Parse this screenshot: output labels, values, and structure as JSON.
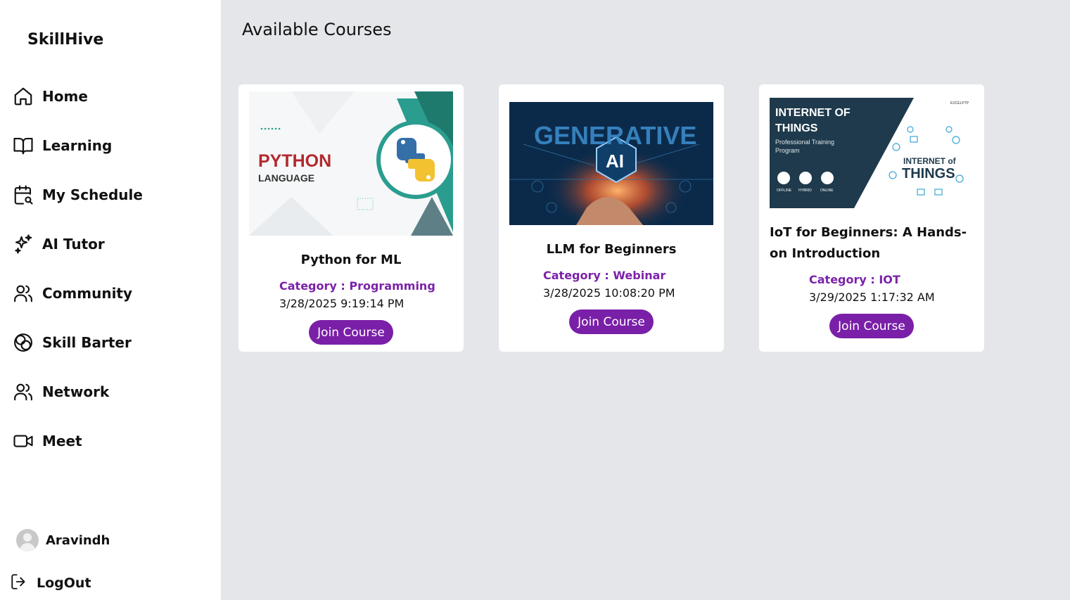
{
  "sidebar": {
    "brand": "SkillHive",
    "items": [
      {
        "label": "Home",
        "icon": "home-icon"
      },
      {
        "label": "Learning",
        "icon": "book-icon"
      },
      {
        "label": "My Schedule",
        "icon": "calendar-search-icon"
      },
      {
        "label": "AI Tutor",
        "icon": "sparkles-icon"
      },
      {
        "label": "Community",
        "icon": "users-icon"
      },
      {
        "label": "Skill Barter",
        "icon": "exchange-circles-icon"
      },
      {
        "label": "Network",
        "icon": "users-icon"
      },
      {
        "label": "Meet",
        "icon": "video-icon"
      }
    ],
    "user": {
      "name": "Aravindh"
    },
    "logout": "LogOut"
  },
  "main": {
    "title": "Available Courses",
    "courses": [
      {
        "title": "Python for ML",
        "category": "Category : Programming",
        "date": "3/28/2025 9:19:14 PM",
        "button": "Join Course",
        "image": {
          "line1": "PYTHON",
          "line2": "LANGUAGE"
        }
      },
      {
        "title": "LLM for Beginners",
        "category": "Category : Webinar",
        "date": "3/28/2025 10:08:20 PM",
        "button": "Join Course",
        "image": {
          "line1": "GENERATIVE",
          "line2": "AI"
        }
      },
      {
        "title": "IoT for Beginners: A Hands-on Introduction",
        "category": "Category : IOT",
        "date": "3/29/2025 1:17:32 AM",
        "button": "Join Course",
        "image": {
          "line1": "INTERNET OF",
          "line2": "THINGS",
          "line3": "Professional Training",
          "line4": "Program",
          "badge": "EXCELPTP",
          "m1": "OFFLINE",
          "m2": "HYBRID",
          "m3": "ONLINE",
          "art1": "INTERNET of",
          "art2": "THINGS"
        }
      }
    ]
  },
  "colors": {
    "accent": "#7a1fa8",
    "category": "#7b22a8",
    "background": "#e5e6ea"
  }
}
